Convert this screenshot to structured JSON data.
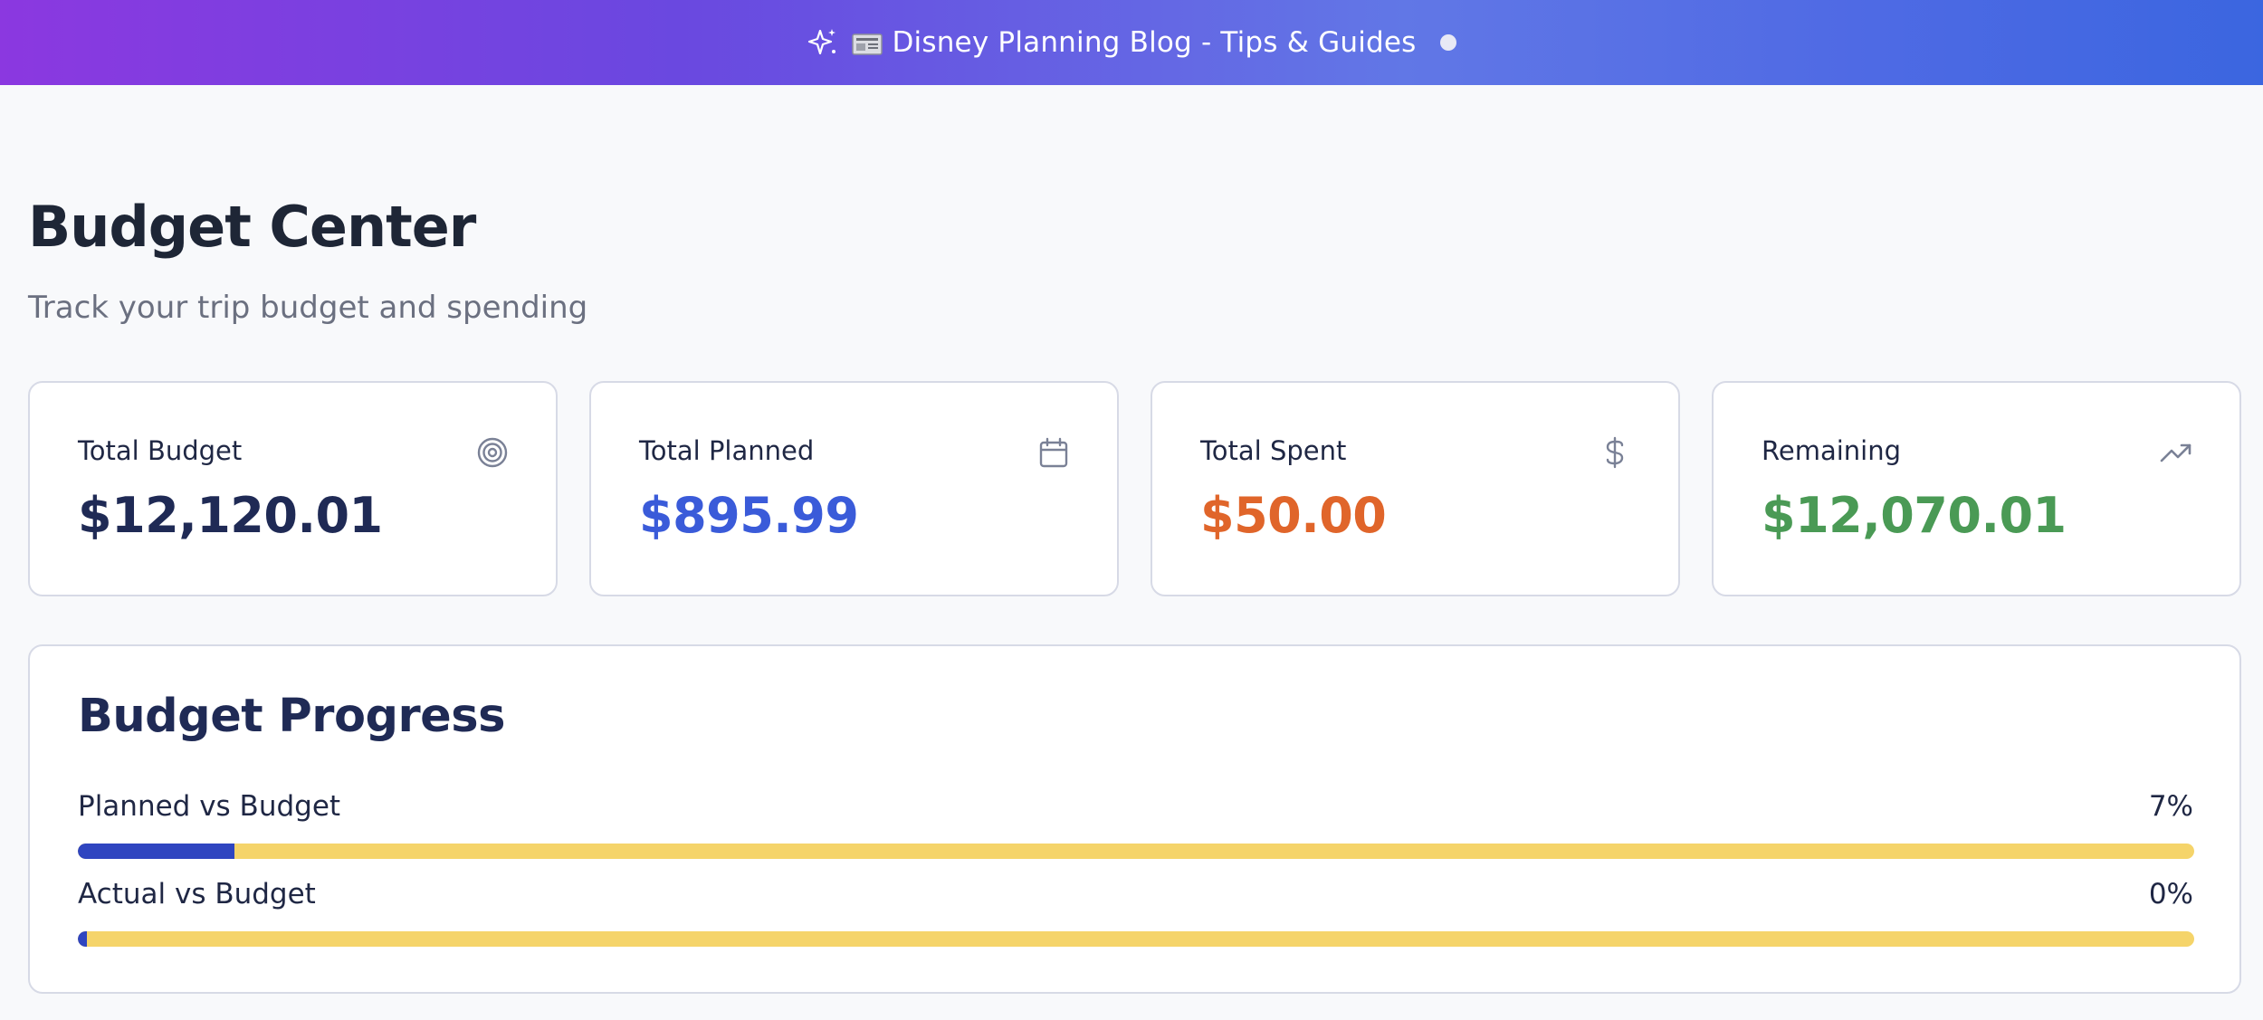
{
  "banner": {
    "text": "Disney Planning Blog - Tips & Guides",
    "icons": [
      "sparkles-icon",
      "newspaper-icon",
      "status-dot-icon"
    ]
  },
  "page": {
    "title": "Budget Center",
    "subtitle": "Track your trip budget and spending"
  },
  "cards": [
    {
      "label": "Total Budget",
      "value": "$12,120.01",
      "icon": "target-icon",
      "color": "#1f2a55"
    },
    {
      "label": "Total Planned",
      "value": "$895.99",
      "icon": "calendar-icon",
      "color": "#3a5bd9"
    },
    {
      "label": "Total Spent",
      "value": "$50.00",
      "icon": "dollar-icon",
      "color": "#e0652a"
    },
    {
      "label": "Remaining",
      "value": "$12,070.01",
      "icon": "trending-up-icon",
      "color": "#4a9a55"
    }
  ],
  "progress": {
    "title": "Budget Progress",
    "rows": [
      {
        "label": "Planned vs Budget",
        "percent_text": "7%",
        "percent": 7.39
      },
      {
        "label": "Actual vs Budget",
        "percent_text": "0%",
        "percent": 0.41
      }
    ]
  },
  "colors": {
    "banner_start": "#8b38e0",
    "banner_end": "#3b66e0",
    "progress_fill": "#2f45c0",
    "progress_track": "#f5d46a"
  }
}
